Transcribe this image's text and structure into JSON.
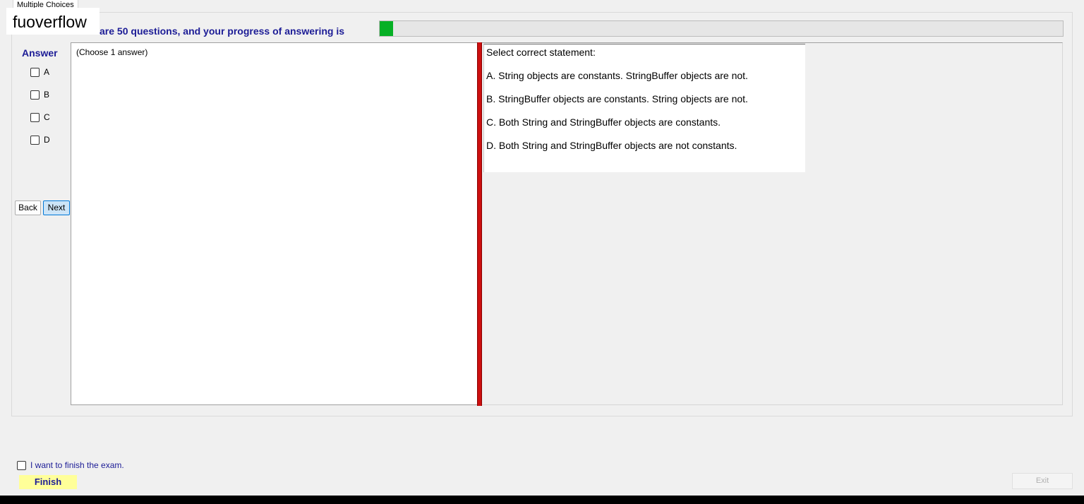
{
  "tab": {
    "label": "Multiple Choices"
  },
  "watermark": "fuoverflow",
  "progress": {
    "text": "There are 50 questions, and your progress of answering is",
    "fraction": 0.02,
    "color": "#06b025"
  },
  "answer": {
    "title": "Answer",
    "options": [
      "A",
      "B",
      "C",
      "D"
    ]
  },
  "nav": {
    "back_label": "Back",
    "next_label": "Next"
  },
  "left_pane": {
    "instruction": "(Choose 1 answer)"
  },
  "question": {
    "prompt": "Select correct statement:",
    "options": [
      "A.  String objects are constants. StringBuffer objects are not.",
      "B.  StringBuffer objects are constants. String objects are not.",
      "C.  Both String and StringBuffer objects are constants.",
      "D.  Both String and StringBuffer objects are not constants."
    ]
  },
  "footer": {
    "finish_checkbox_label": "I want to finish the exam.",
    "finish_label": "Finish",
    "exit_label": "Exit"
  },
  "colors": {
    "accent_text": "#1c1c96",
    "splitter": "#cc1010",
    "finish_bg": "#ffff99"
  }
}
